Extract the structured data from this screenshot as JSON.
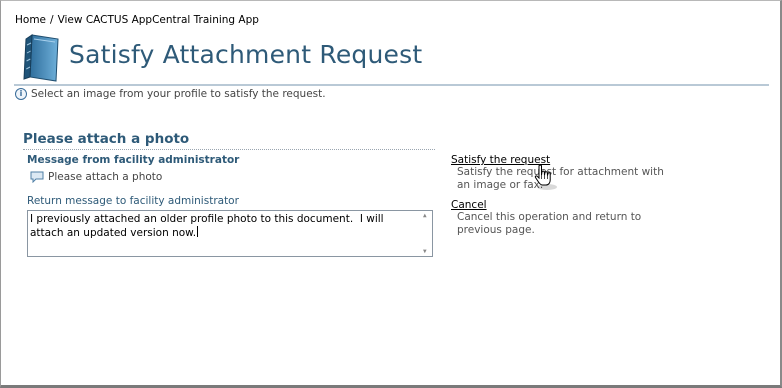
{
  "breadcrumb": {
    "home": "Home",
    "separator": "/",
    "current": "View CACTUS AppCentral Training App"
  },
  "header": {
    "title": "Satisfy Attachment Request",
    "info": "Select an image from your profile to satisfy the request."
  },
  "main": {
    "section_title": "Please attach a photo",
    "message_heading": "Message from facility administrator",
    "message_text": "Please attach a photo",
    "return_label": "Return message to facility administrator",
    "return_value": "I previously attached an older profile photo to this document.  I will attach an updated version now."
  },
  "actions": {
    "satisfy_label": "Satisfy the request",
    "satisfy_desc": "Satisfy the request for attachment with an image or fax.",
    "cancel_label": "Cancel",
    "cancel_desc": "Cancel this operation and return to previous page."
  },
  "icons": {
    "book": "book-icon",
    "info": "info-icon",
    "message": "speech-bubble-icon",
    "cursor": "hand-pointer-icon"
  },
  "colors": {
    "title": "#2e5a78",
    "rule": "#b9c9d6"
  }
}
